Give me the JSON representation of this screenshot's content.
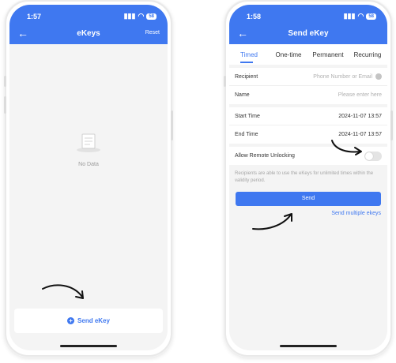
{
  "left_phone": {
    "status": {
      "time": "1:57",
      "battery": "58"
    },
    "nav": {
      "title": "eKeys",
      "right_action": "Reset"
    },
    "empty_state": {
      "text": "No Data"
    },
    "send_button": {
      "label": "Send eKey"
    }
  },
  "right_phone": {
    "status": {
      "time": "1:58",
      "battery": "58"
    },
    "nav": {
      "title": "Send eKey"
    },
    "tabs": [
      "Timed",
      "One-time",
      "Permanent",
      "Recurring"
    ],
    "active_tab": "Timed",
    "form": {
      "recipient": {
        "label": "Recipient",
        "placeholder": "Phone Number or Email"
      },
      "name": {
        "label": "Name",
        "placeholder": "Please enter here"
      },
      "start_time": {
        "label": "Start Time",
        "value": "2024-11-07 13:57"
      },
      "end_time": {
        "label": "End Time",
        "value": "2024-11-07 13:57"
      },
      "remote_unlock": {
        "label": "Allow Remote Unlocking",
        "enabled": false
      }
    },
    "hint": "Recipients are able to use the eKeys for unlimited times within the validity period.",
    "send_label": "Send",
    "multi_label": "Send multiple ekeys"
  },
  "colors": {
    "accent": "#3f78f0",
    "background": "#f4f4f4"
  },
  "icons": [
    "back-arrow-icon",
    "person-icon",
    "signal-icon",
    "wifi-icon",
    "battery-icon",
    "document-icon",
    "plus-circle-icon",
    "contact-icon",
    "annotation-arrow-icon"
  ]
}
